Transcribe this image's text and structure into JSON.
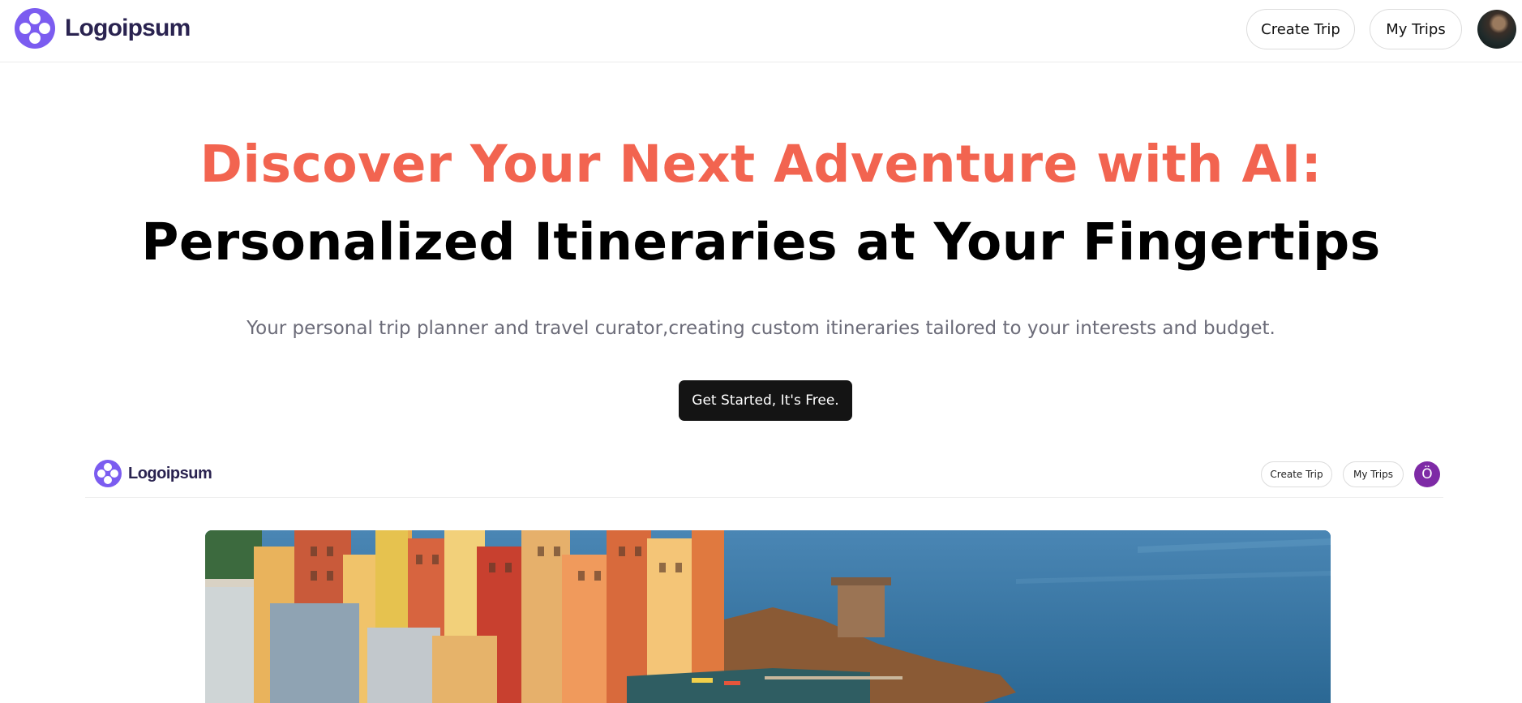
{
  "header": {
    "brand": "Logoipsum",
    "nav": {
      "create_trip": "Create Trip",
      "my_trips": "My Trips"
    }
  },
  "hero": {
    "headline_line1": "Discover Your Next Adventure with AI:",
    "headline_line2": "Personalized Itineraries at Your Fingertips",
    "subtitle": "Your personal trip planner and travel curator,creating custom itineraries tailored to your interests and budget.",
    "cta_label": "Get Started, It's Free."
  },
  "preview": {
    "brand": "Logoipsum",
    "nav": {
      "create_trip": "Create Trip",
      "my_trips": "My Trips"
    },
    "avatar_initial": "Ö"
  },
  "colors": {
    "accent": "#f26450",
    "brand": "#7b5cf0",
    "cta_bg": "#141414",
    "subtitle": "#6b6b78",
    "preview_avatar": "#7e2aa6"
  },
  "icons": [
    "logo-icon",
    "user-avatar",
    "coastal-village-photo"
  ]
}
